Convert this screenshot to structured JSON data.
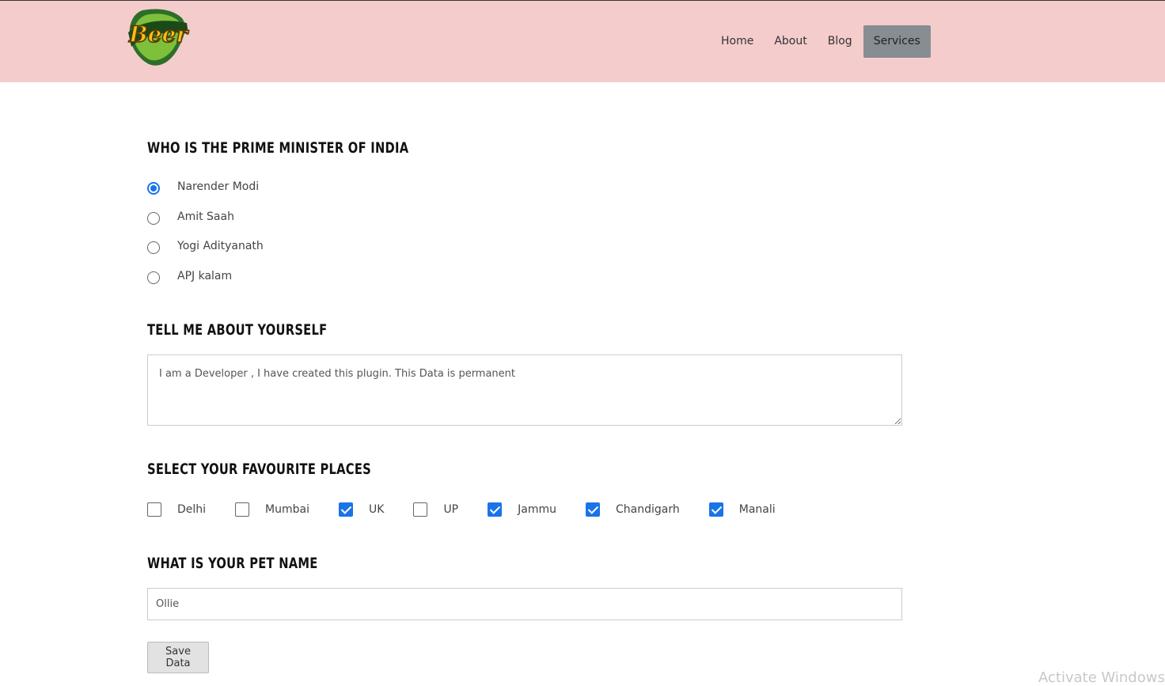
{
  "header": {
    "logo_text": "Beer",
    "nav": [
      {
        "label": "Home"
      },
      {
        "label": "About"
      },
      {
        "label": "Blog"
      },
      {
        "label": "Services",
        "active": true
      }
    ],
    "bg_color": "#f5cccc"
  },
  "q1": {
    "title": "Who is the Prime Minister of India",
    "options": [
      {
        "label": "Narender Modi",
        "checked": true
      },
      {
        "label": "Amit Saah",
        "checked": false
      },
      {
        "label": "Yogi Adityanath",
        "checked": false
      },
      {
        "label": "APJ kalam",
        "checked": false
      }
    ]
  },
  "q2": {
    "title": "Tell me about yourself",
    "value": "I am a Developer , I have created this plugin. This Data is permanent"
  },
  "q3": {
    "title": "Select your favourite places",
    "options": [
      {
        "label": "Delhi",
        "checked": false
      },
      {
        "label": "Mumbai",
        "checked": false
      },
      {
        "label": "UK",
        "checked": true
      },
      {
        "label": "UP",
        "checked": false
      },
      {
        "label": "Jammu",
        "checked": true
      },
      {
        "label": "Chandigarh",
        "checked": true
      },
      {
        "label": "Manali",
        "checked": true
      }
    ]
  },
  "q4": {
    "title": "What is your pet name",
    "value": "Ollie"
  },
  "save_label": "Save Data",
  "watermark": "Activate Windows",
  "accent_color": "#1a73e8"
}
